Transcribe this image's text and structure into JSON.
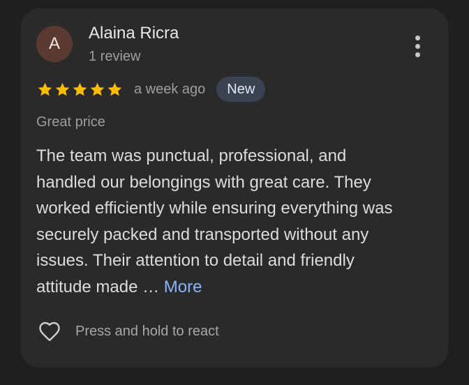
{
  "review": {
    "author": {
      "initial": "A",
      "avatar_color": "#5b3a32",
      "name": "Alaina Ricra",
      "review_count": "1 review"
    },
    "rating": 5,
    "star_color": "#fbbc04",
    "time_ago": "a week ago",
    "badge": "New",
    "tag": "Great price",
    "text_lines": [
      "The team was punctual, professional, and",
      "handled our belongings with great care. They",
      "worked efficiently while ensuring everything was",
      "securely packed and transported without any",
      "issues. Their attention to detail and friendly",
      "attitude made … "
    ],
    "more_label": "More",
    "link_color": "#8ab4f8",
    "react_label": "Press and hold to react"
  },
  "icons": {
    "more": "more-vert-icon",
    "star": "star-icon",
    "react": "heart-outline-icon"
  }
}
